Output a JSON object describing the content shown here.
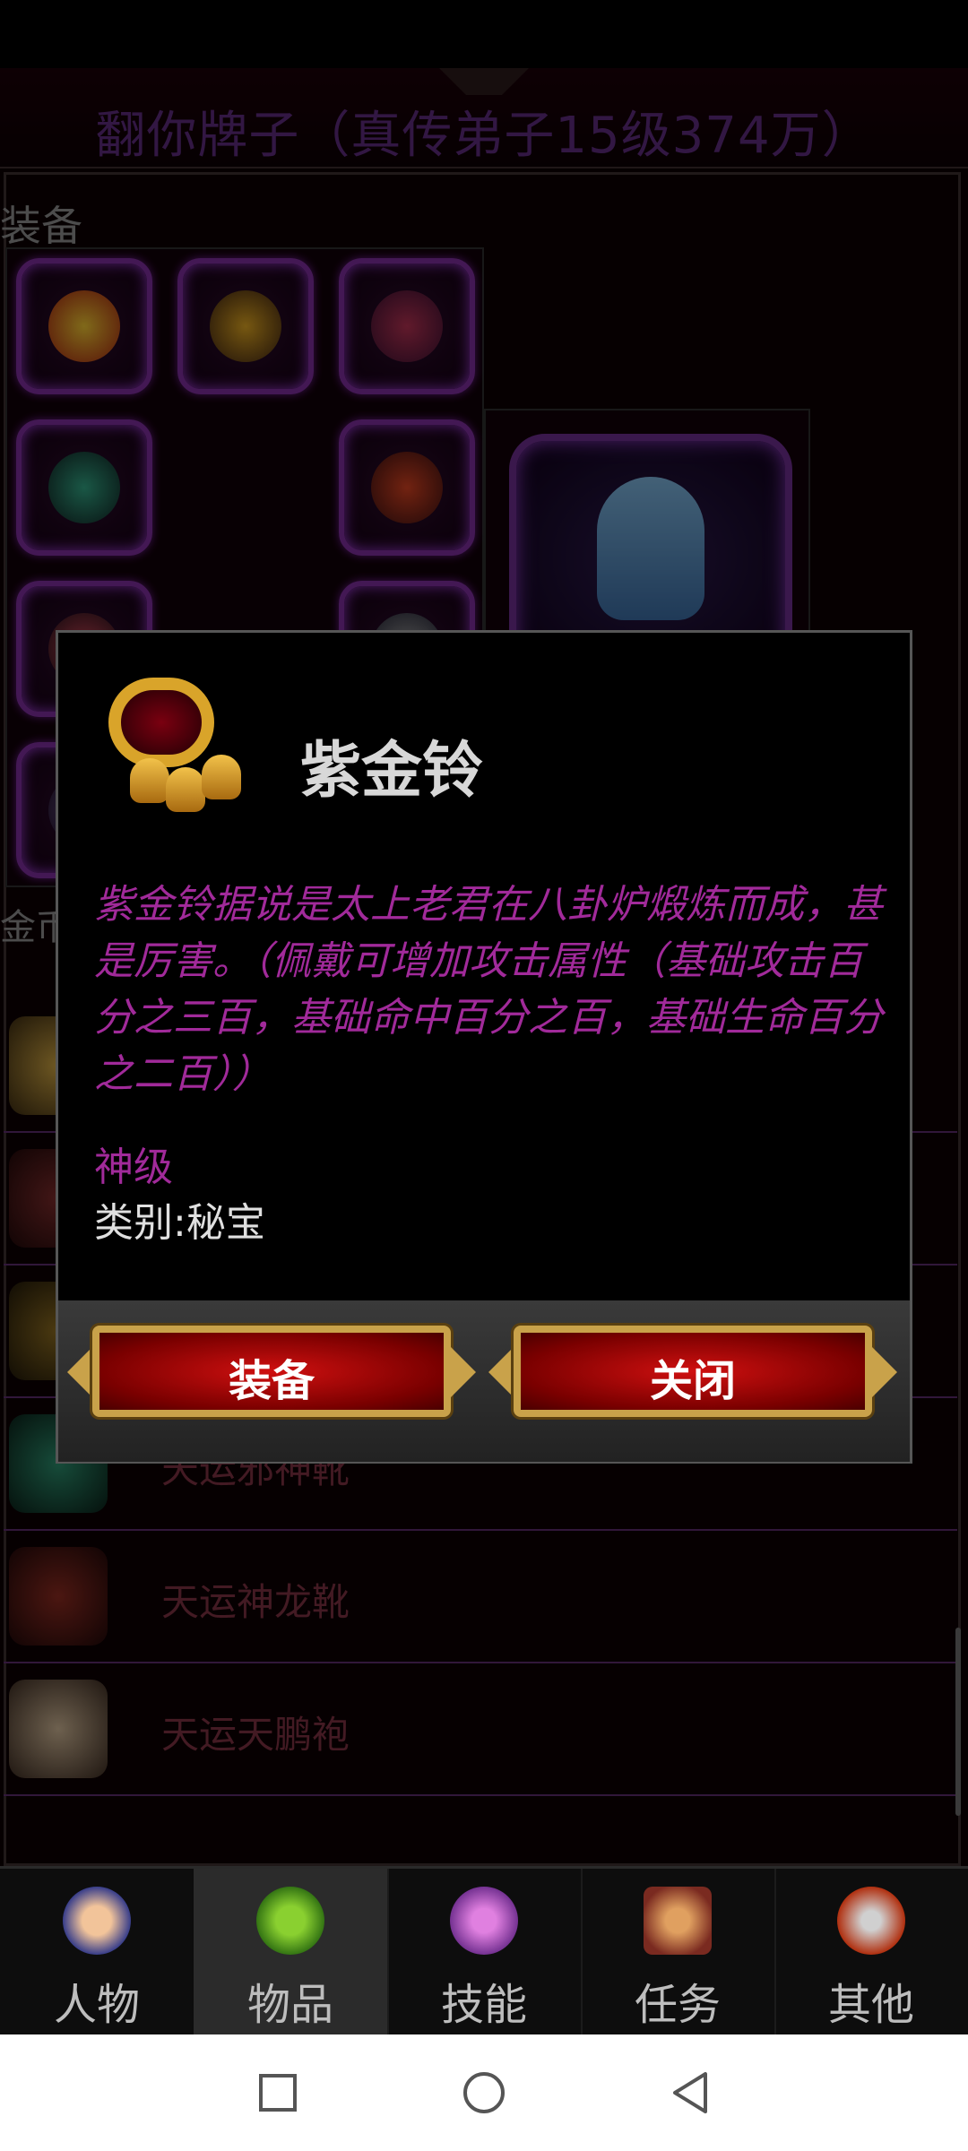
{
  "header": {
    "title": "翻你牌子（真传弟子15级374万）"
  },
  "equipment": {
    "section_label": "装备",
    "gold_label": "金币:"
  },
  "items": [
    {
      "name": "",
      "icon": "beast-armor-icon",
      "color": "#c9a040"
    },
    {
      "name": "",
      "icon": "dragon-armor-icon",
      "color": "#7a2a2a"
    },
    {
      "name": "",
      "icon": "golden-ring-icon",
      "color": "#8a6a20"
    },
    {
      "name": "天运邪神靴",
      "icon": "green-boots-icon",
      "color": "#2a8a6a"
    },
    {
      "name": "天运神龙靴",
      "icon": "red-boots-icon",
      "color": "#8a2a20"
    },
    {
      "name": "天运天鹏袍",
      "icon": "bone-robe-icon",
      "color": "#c8b090"
    }
  ],
  "popup": {
    "item_name": "紫金铃",
    "description": "紫金铃据说是太上老君在八卦炉煅炼而成，甚是厉害。（佩戴可增加攻击属性（基础攻击百分之三百，基础命中百分之百，基础生命百分之二百））",
    "grade": "神级",
    "category": "类别:秘宝",
    "equip_label": "装备",
    "close_label": "关闭"
  },
  "nav": {
    "tabs": [
      {
        "label": "人物",
        "icon": "character-icon",
        "active": false
      },
      {
        "label": "物品",
        "icon": "potion-bag-icon",
        "active": true
      },
      {
        "label": "技能",
        "icon": "magic-swirl-icon",
        "active": false
      },
      {
        "label": "任务",
        "icon": "quest-icon",
        "active": false
      },
      {
        "label": "其他",
        "icon": "sword-icon",
        "active": false
      }
    ]
  },
  "system_nav": {
    "buttons": [
      "recents-square-icon",
      "home-circle-icon",
      "back-triangle-icon"
    ]
  }
}
